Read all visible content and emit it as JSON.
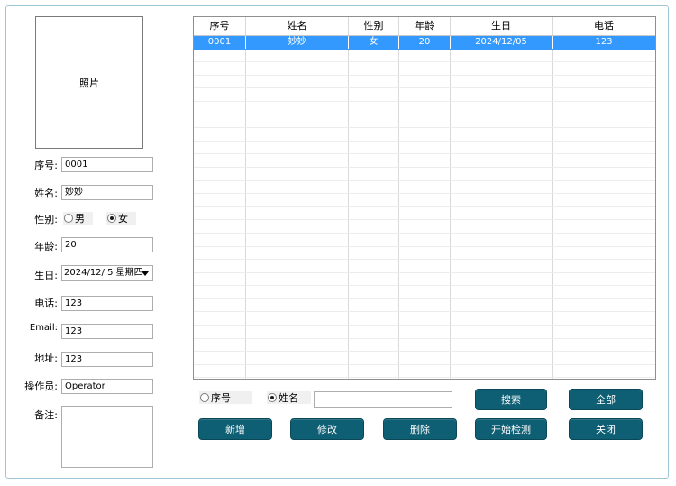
{
  "photo": {
    "label": "照片"
  },
  "form": {
    "seq_label": "序号:",
    "seq_value": "0001",
    "name_label": "姓名:",
    "name_value": "妙妙",
    "gender_label": "性别:",
    "gender_male": "男",
    "gender_female": "女",
    "gender_selected": "女",
    "age_label": "年龄:",
    "age_value": "20",
    "birthday_label": "生日:",
    "birthday_value": "2024/12/  5 星期四",
    "phone_label": "电话:",
    "phone_value": "123",
    "email_label": "Email:",
    "email_value": "123",
    "address_label": "地址:",
    "address_value": "123",
    "operator_label": "操作员:",
    "operator_value": "Operator",
    "notes_label": "备注:",
    "notes_value": ""
  },
  "grid": {
    "columns": [
      "序号",
      "姓名",
      "性别",
      "年龄",
      "生日",
      "电话"
    ],
    "rows": [
      [
        "0001",
        "妙妙",
        "女",
        "20",
        "2024/12/05",
        "123"
      ]
    ],
    "selected_row": 0
  },
  "search": {
    "option_seq": "序号",
    "option_name": "姓名",
    "selected_option": "姓名",
    "query": ""
  },
  "buttons": {
    "search": "搜索",
    "all": "全部",
    "add": "新增",
    "edit": "修改",
    "delete": "删除",
    "start_detect": "开始检测",
    "close": "关闭"
  },
  "colors": {
    "button_bg": "#0f5f74",
    "selection": "#3399ff",
    "frame_border": "#9fc6d4"
  }
}
